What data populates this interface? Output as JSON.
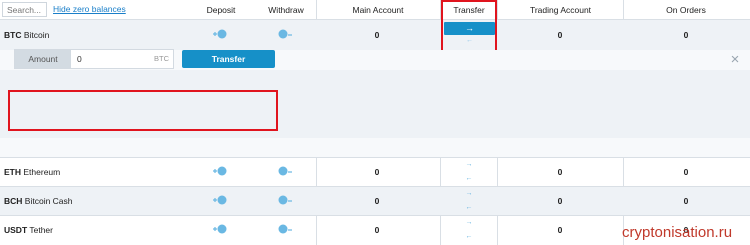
{
  "header": {
    "search_placeholder": "Search...",
    "hide_zero_label": "Hide zero balances",
    "columns": {
      "deposit": "Deposit",
      "withdraw": "Withdraw",
      "main_account": "Main Account",
      "transfer": "Transfer",
      "trading_account": "Trading Account",
      "on_orders": "On Orders"
    }
  },
  "rows": [
    {
      "symbol": "BTC",
      "name": "Bitcoin",
      "main": "0",
      "trading": "0",
      "orders": "0"
    },
    {
      "symbol": "ETH",
      "name": "Ethereum",
      "main": "0",
      "trading": "0",
      "orders": "0"
    },
    {
      "symbol": "BCH",
      "name": "Bitcoin Cash",
      "main": "0",
      "trading": "0",
      "orders": "0"
    },
    {
      "symbol": "USDT",
      "name": "Tether",
      "main": "0",
      "trading": "0",
      "orders": "0"
    }
  ],
  "transfer_panel": {
    "amount_label": "Amount",
    "amount_value": "0",
    "amount_unit": "BTC",
    "button_label": "Transfer",
    "close_glyph": "×"
  },
  "icons": {
    "deposit": "deposit-icon",
    "withdraw": "withdraw-icon",
    "arrow_right": "→",
    "arrow_left": "←"
  },
  "watermark": "cryptonisation.ru",
  "colors": {
    "accent": "#1690c8",
    "highlight": "#e0141e",
    "link": "#1a7fc9"
  }
}
